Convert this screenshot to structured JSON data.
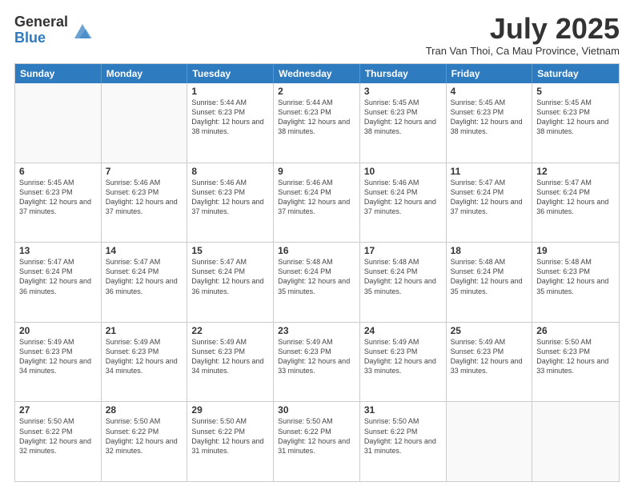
{
  "logo": {
    "general": "General",
    "blue": "Blue"
  },
  "title": "July 2025",
  "subtitle": "Tran Van Thoi, Ca Mau Province, Vietnam",
  "header_days": [
    "Sunday",
    "Monday",
    "Tuesday",
    "Wednesday",
    "Thursday",
    "Friday",
    "Saturday"
  ],
  "weeks": [
    [
      {
        "day": "",
        "info": "",
        "empty": true
      },
      {
        "day": "",
        "info": "",
        "empty": true
      },
      {
        "day": "1",
        "info": "Sunrise: 5:44 AM\nSunset: 6:23 PM\nDaylight: 12 hours and 38 minutes."
      },
      {
        "day": "2",
        "info": "Sunrise: 5:44 AM\nSunset: 6:23 PM\nDaylight: 12 hours and 38 minutes."
      },
      {
        "day": "3",
        "info": "Sunrise: 5:45 AM\nSunset: 6:23 PM\nDaylight: 12 hours and 38 minutes."
      },
      {
        "day": "4",
        "info": "Sunrise: 5:45 AM\nSunset: 6:23 PM\nDaylight: 12 hours and 38 minutes."
      },
      {
        "day": "5",
        "info": "Sunrise: 5:45 AM\nSunset: 6:23 PM\nDaylight: 12 hours and 38 minutes."
      }
    ],
    [
      {
        "day": "6",
        "info": "Sunrise: 5:45 AM\nSunset: 6:23 PM\nDaylight: 12 hours and 37 minutes."
      },
      {
        "day": "7",
        "info": "Sunrise: 5:46 AM\nSunset: 6:23 PM\nDaylight: 12 hours and 37 minutes."
      },
      {
        "day": "8",
        "info": "Sunrise: 5:46 AM\nSunset: 6:23 PM\nDaylight: 12 hours and 37 minutes."
      },
      {
        "day": "9",
        "info": "Sunrise: 5:46 AM\nSunset: 6:24 PM\nDaylight: 12 hours and 37 minutes."
      },
      {
        "day": "10",
        "info": "Sunrise: 5:46 AM\nSunset: 6:24 PM\nDaylight: 12 hours and 37 minutes."
      },
      {
        "day": "11",
        "info": "Sunrise: 5:47 AM\nSunset: 6:24 PM\nDaylight: 12 hours and 37 minutes."
      },
      {
        "day": "12",
        "info": "Sunrise: 5:47 AM\nSunset: 6:24 PM\nDaylight: 12 hours and 36 minutes."
      }
    ],
    [
      {
        "day": "13",
        "info": "Sunrise: 5:47 AM\nSunset: 6:24 PM\nDaylight: 12 hours and 36 minutes."
      },
      {
        "day": "14",
        "info": "Sunrise: 5:47 AM\nSunset: 6:24 PM\nDaylight: 12 hours and 36 minutes."
      },
      {
        "day": "15",
        "info": "Sunrise: 5:47 AM\nSunset: 6:24 PM\nDaylight: 12 hours and 36 minutes."
      },
      {
        "day": "16",
        "info": "Sunrise: 5:48 AM\nSunset: 6:24 PM\nDaylight: 12 hours and 35 minutes."
      },
      {
        "day": "17",
        "info": "Sunrise: 5:48 AM\nSunset: 6:24 PM\nDaylight: 12 hours and 35 minutes."
      },
      {
        "day": "18",
        "info": "Sunrise: 5:48 AM\nSunset: 6:24 PM\nDaylight: 12 hours and 35 minutes."
      },
      {
        "day": "19",
        "info": "Sunrise: 5:48 AM\nSunset: 6:23 PM\nDaylight: 12 hours and 35 minutes."
      }
    ],
    [
      {
        "day": "20",
        "info": "Sunrise: 5:49 AM\nSunset: 6:23 PM\nDaylight: 12 hours and 34 minutes."
      },
      {
        "day": "21",
        "info": "Sunrise: 5:49 AM\nSunset: 6:23 PM\nDaylight: 12 hours and 34 minutes."
      },
      {
        "day": "22",
        "info": "Sunrise: 5:49 AM\nSunset: 6:23 PM\nDaylight: 12 hours and 34 minutes."
      },
      {
        "day": "23",
        "info": "Sunrise: 5:49 AM\nSunset: 6:23 PM\nDaylight: 12 hours and 33 minutes."
      },
      {
        "day": "24",
        "info": "Sunrise: 5:49 AM\nSunset: 6:23 PM\nDaylight: 12 hours and 33 minutes."
      },
      {
        "day": "25",
        "info": "Sunrise: 5:49 AM\nSunset: 6:23 PM\nDaylight: 12 hours and 33 minutes."
      },
      {
        "day": "26",
        "info": "Sunrise: 5:50 AM\nSunset: 6:23 PM\nDaylight: 12 hours and 33 minutes."
      }
    ],
    [
      {
        "day": "27",
        "info": "Sunrise: 5:50 AM\nSunset: 6:22 PM\nDaylight: 12 hours and 32 minutes."
      },
      {
        "day": "28",
        "info": "Sunrise: 5:50 AM\nSunset: 6:22 PM\nDaylight: 12 hours and 32 minutes."
      },
      {
        "day": "29",
        "info": "Sunrise: 5:50 AM\nSunset: 6:22 PM\nDaylight: 12 hours and 31 minutes."
      },
      {
        "day": "30",
        "info": "Sunrise: 5:50 AM\nSunset: 6:22 PM\nDaylight: 12 hours and 31 minutes."
      },
      {
        "day": "31",
        "info": "Sunrise: 5:50 AM\nSunset: 6:22 PM\nDaylight: 12 hours and 31 minutes."
      },
      {
        "day": "",
        "info": "",
        "empty": true
      },
      {
        "day": "",
        "info": "",
        "empty": true
      }
    ]
  ]
}
